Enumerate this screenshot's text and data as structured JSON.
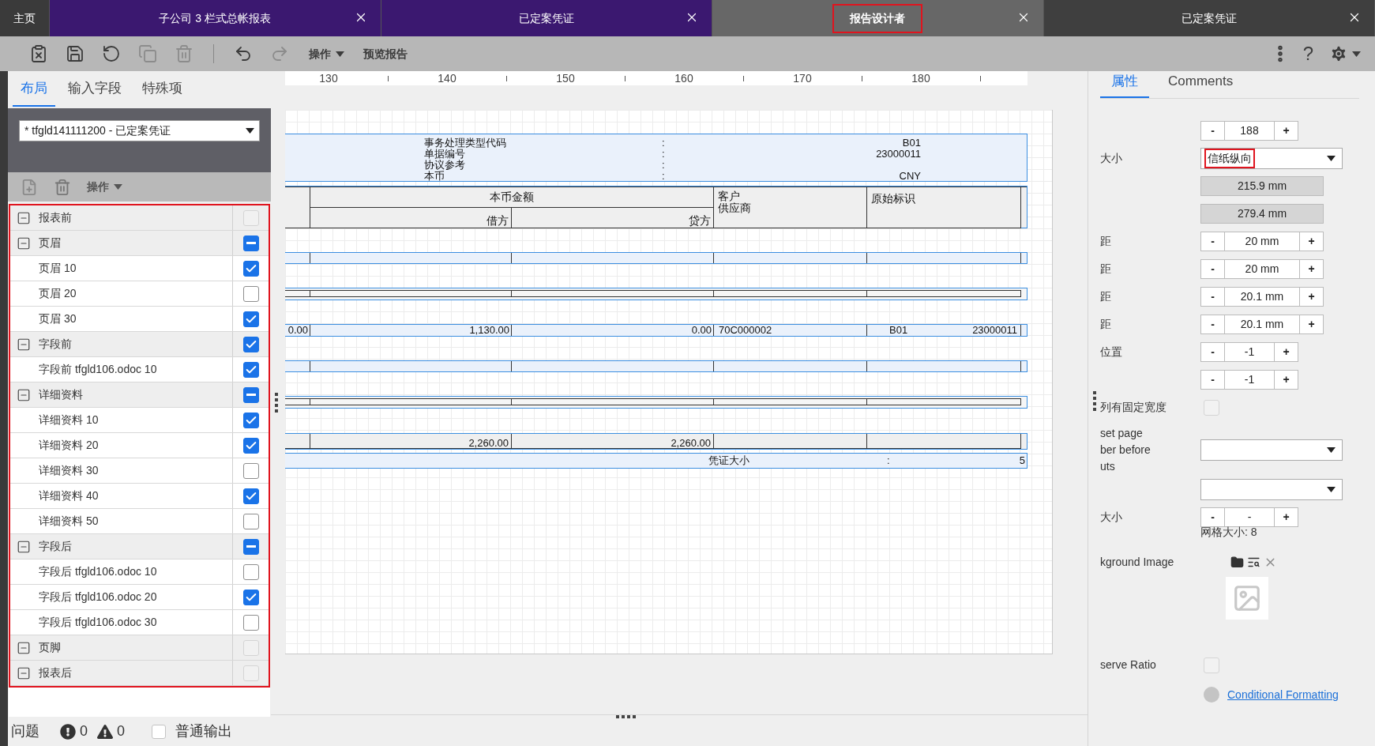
{
  "tabs": [
    {
      "label": "主页",
      "kind": "home",
      "selected": false,
      "color": "#3a3a3a",
      "annotated": false
    },
    {
      "label": "子公司 3 栏式总帐报表",
      "kind": "document",
      "selected": false,
      "color": "#3b1870",
      "annotated": false
    },
    {
      "label": "已定案凭证",
      "kind": "document",
      "selected": false,
      "color": "#3b1870",
      "annotated": false
    },
    {
      "label": "报告设计者",
      "kind": "document",
      "selected": true,
      "color": "#676767",
      "annotated": true
    },
    {
      "label": "已定案凭证",
      "kind": "document",
      "selected": false,
      "color": "#3f3f3f",
      "annotated": false
    }
  ],
  "toolbar": {
    "buttons": [
      {
        "kind": "clear",
        "disabled": false
      },
      {
        "kind": "save",
        "disabled": false
      },
      {
        "kind": "refresh",
        "disabled": false
      },
      {
        "kind": "copy",
        "disabled": true
      },
      {
        "kind": "delete",
        "disabled": true
      },
      {
        "kind": "undo",
        "disabled": false
      },
      {
        "kind": "redo",
        "disabled": true
      }
    ],
    "menu": "操作",
    "preview": "预览报告",
    "help": "?"
  },
  "left_panel": {
    "tabs": [
      {
        "label": "布局",
        "selected": true
      },
      {
        "label": "输入字段",
        "selected": false
      },
      {
        "label": "特殊项",
        "selected": false
      }
    ],
    "report_select": {
      "value": "* tfgld141111200 - 已定案凭证"
    },
    "tree_toolbar": {
      "menu": "操作"
    },
    "tree": {
      "annotated": true,
      "groups": [
        {
          "label": "报表前",
          "expanded": true,
          "checked": false,
          "partial": false,
          "disabled": true
        },
        {
          "label": "页眉",
          "expanded": true,
          "checked": false,
          "partial": true,
          "disabled": false,
          "children": [
            {
              "label": "页眉 10",
              "checked": true
            },
            {
              "label": "页眉 20",
              "checked": false
            },
            {
              "label": "页眉 30",
              "checked": true
            }
          ]
        },
        {
          "label": "字段前",
          "expanded": true,
          "checked": true,
          "partial": false,
          "disabled": false,
          "children": [
            {
              "label": "字段前 tfgld106.odoc 10",
              "checked": true
            }
          ]
        },
        {
          "label": "详细资料",
          "expanded": true,
          "checked": false,
          "partial": true,
          "disabled": false,
          "children": [
            {
              "label": "详细资料 10",
              "checked": true
            },
            {
              "label": "详细资料 20",
              "checked": true
            },
            {
              "label": "详细资料 30",
              "checked": false
            },
            {
              "label": "详细资料 40",
              "checked": true
            },
            {
              "label": "详细资料 50",
              "checked": false
            }
          ]
        },
        {
          "label": "字段后",
          "expanded": true,
          "checked": false,
          "partial": true,
          "disabled": false,
          "children": [
            {
              "label": "字段后 tfgld106.odoc 10",
              "checked": false
            },
            {
              "label": "字段后 tfgld106.odoc 20",
              "checked": true
            },
            {
              "label": "字段后 tfgld106.odoc 30",
              "checked": false
            }
          ]
        },
        {
          "label": "页脚",
          "expanded": true,
          "checked": false,
          "partial": false,
          "disabled": true
        },
        {
          "label": "报表后",
          "expanded": true,
          "checked": false,
          "partial": false,
          "disabled": true
        }
      ]
    },
    "status_bar": {
      "label": "问题",
      "errors": "0",
      "warnings": "0",
      "plain_output": {
        "label": "普通输出",
        "checked": false
      }
    }
  },
  "designer": {
    "ruler": [
      "130",
      "140",
      "150",
      "160",
      "170",
      "180"
    ],
    "bands": [
      {
        "kind": "header",
        "rows": [
          {
            "label": "事务处理类型代码",
            "separator": ":",
            "value": "B01"
          },
          {
            "label": "单据编号",
            "separator": ":",
            "value": "23000011"
          },
          {
            "label": "协议参考",
            "separator": ":"
          },
          {
            "label": "本币",
            "separator": ":",
            "value": "CNY"
          }
        ]
      },
      {
        "kind": "columns",
        "group": "本币金额",
        "debit": "借方",
        "credit": "贷方",
        "party": [
          "客户",
          "供应商"
        ],
        "origin": "原始标识"
      },
      {
        "kind": "blank"
      },
      {
        "kind": "rule"
      },
      {
        "kind": "data",
        "cells": [
          "0.00",
          "1,130.00",
          "0.00",
          "70C000002"
        ],
        "origin_code": "B01",
        "origin_number": "23000011"
      },
      {
        "kind": "blank"
      },
      {
        "kind": "rule"
      },
      {
        "kind": "totals",
        "debit": "2,260.00",
        "credit": "2,260.00"
      },
      {
        "kind": "footer",
        "label": "凭证大小",
        "separator": ":",
        "value": "5"
      }
    ]
  },
  "properties": {
    "tabs": [
      {
        "label": "属性",
        "selected": true
      },
      {
        "label": "Comments",
        "selected": false
      }
    ],
    "rows": [
      {
        "kind": "stepper",
        "value": "188",
        "wide": false,
        "decrement": "-",
        "increment": "+"
      },
      {
        "kind": "select",
        "label": "大小",
        "value": "信纸纵向",
        "annotated": true
      },
      {
        "kind": "readonly",
        "value": "215.9 mm"
      },
      {
        "kind": "readonly",
        "value": "279.4 mm"
      },
      {
        "kind": "stepper",
        "label": "距",
        "value": "20 mm",
        "wide": true,
        "decrement": "-",
        "increment": "+"
      },
      {
        "kind": "stepper",
        "label": "距",
        "value": "20 mm",
        "wide": true,
        "decrement": "-",
        "increment": "+"
      },
      {
        "kind": "stepper",
        "label": "距",
        "value": "20.1 mm",
        "wide": true,
        "decrement": "-",
        "increment": "+"
      },
      {
        "kind": "stepper",
        "label": "距",
        "value": "20.1 mm",
        "wide": true,
        "decrement": "-",
        "increment": "+"
      },
      {
        "kind": "stepper",
        "label": "位置",
        "value": "-1",
        "wide": false,
        "decrement": "-",
        "increment": "+"
      },
      {
        "kind": "stepper",
        "value": "-1",
        "wide": false,
        "decrement": "-",
        "increment": "+"
      },
      {
        "kind": "checkbox",
        "label": "列有固定宽度",
        "checked": false
      },
      {
        "kind": "multiline_select",
        "lines": [
          "set page",
          "ber before",
          "uts"
        ]
      },
      {
        "kind": "select"
      },
      {
        "kind": "stepper",
        "label": "大小",
        "value": "-",
        "wide": false,
        "note": "网格大小: 8",
        "decrement": "-",
        "increment": "+"
      },
      {
        "kind": "image",
        "label": "kground Image"
      },
      {
        "kind": "checkbox",
        "label": "serve Ratio",
        "checked": false
      },
      {
        "kind": "link",
        "label": "Conditional Formatting"
      }
    ]
  }
}
